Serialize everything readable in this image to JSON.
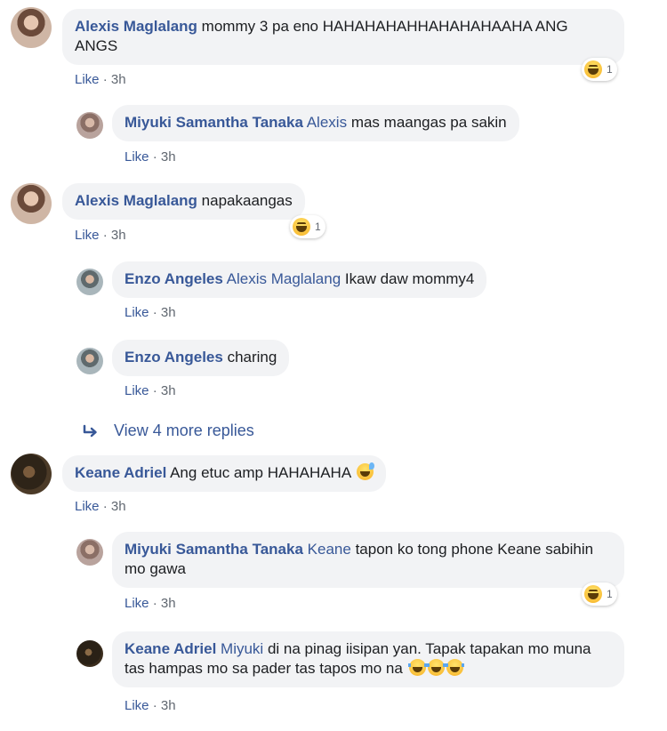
{
  "comments": [
    {
      "author": "Alexis Maglalang",
      "text": "mommy 3 pa eno HAHAHAHAHHAHAHAHAAHA ANG ANGS",
      "like": "Like",
      "dot": "·",
      "time": "3h",
      "reaction_count": "1"
    },
    {
      "author": "Miyuki Samantha Tanaka",
      "tag": "Alexis",
      "text": "mas maangas pa sakin",
      "like": "Like",
      "dot": "·",
      "time": "3h"
    },
    {
      "author": "Alexis Maglalang",
      "text": "napakaangas",
      "like": "Like",
      "dot": "·",
      "time": "3h",
      "reaction_count": "1"
    },
    {
      "author": "Enzo Angeles",
      "tag": "Alexis Maglalang",
      "text": "Ikaw daw mommy4",
      "like": "Like",
      "dot": "·",
      "time": "3h"
    },
    {
      "author": "Enzo Angeles",
      "text": "charing",
      "like": "Like",
      "dot": "·",
      "time": "3h"
    },
    {
      "author": "Keane Adriel",
      "text": "Ang etuc amp HAHAHAHA",
      "like": "Like",
      "dot": "·",
      "time": "3h"
    },
    {
      "author": "Miyuki Samantha Tanaka",
      "tag": "Keane",
      "text": "tapon ko tong phone Keane sabihin mo gawa",
      "like": "Like",
      "dot": "·",
      "time": "3h",
      "reaction_count": "1"
    },
    {
      "author": "Keane Adriel",
      "tag": "Miyuki",
      "text": "di na pinag iisipan yan. Tapak tapakan mo muna tas hampas mo sa pader tas tapos mo na",
      "like": "Like",
      "dot": "·",
      "time": "3h"
    }
  ],
  "view_more": "View 4 more replies",
  "icons": {
    "reaction": "haha-reaction-icon",
    "reply_arrow": "reply-arrow-icon",
    "emoji_sweat": "grinning-sweat-emoji",
    "emoji_tears": "tears-of-joy-emoji"
  },
  "colors": {
    "link": "#385898",
    "bubble": "#f2f3f5",
    "meta": "#606770"
  }
}
